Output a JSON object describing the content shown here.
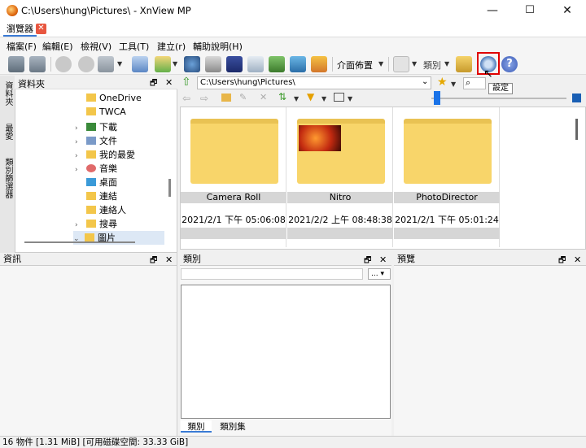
{
  "window": {
    "title": "C:\\Users\\hung\\Pictures\\ - XnView MP",
    "min": "—",
    "max": "☐",
    "close": "✕"
  },
  "tab": {
    "label": "瀏覽器",
    "close": "✕"
  },
  "menu": [
    "檔案(F)",
    "編輯(E)",
    "檢視(V)",
    "工具(T)",
    "建立(r)",
    "輔助說明(H)"
  ],
  "toolbar": {
    "layout_label": "介面佈置",
    "category_label": "類別",
    "settings_tooltip": "設定"
  },
  "sidebar_tabs": [
    "資料夾",
    "最愛",
    "類別篩選器"
  ],
  "folders_panel": {
    "title": "資料夾",
    "pin": "🗗",
    "close": "✕"
  },
  "tree": [
    {
      "label": "OneDrive",
      "expander": "",
      "icon": "folder"
    },
    {
      "label": "TWCA",
      "expander": "",
      "icon": "folder"
    },
    {
      "label": "下載",
      "expander": "›",
      "icon": "download"
    },
    {
      "label": "文件",
      "expander": "›",
      "icon": "doc"
    },
    {
      "label": "我的最愛",
      "expander": "›",
      "icon": "folder"
    },
    {
      "label": "音樂",
      "expander": "›",
      "icon": "music"
    },
    {
      "label": "桌面",
      "expander": "",
      "icon": "desktop"
    },
    {
      "label": "連結",
      "expander": "",
      "icon": "folder"
    },
    {
      "label": "連絡人",
      "expander": "",
      "icon": "folder"
    },
    {
      "label": "搜尋",
      "expander": "›",
      "icon": "folder"
    },
    {
      "label": "圖片",
      "expander": "⌄",
      "icon": "folder"
    }
  ],
  "path": {
    "value": "C:\\Users\\hung\\Pictures\\",
    "dropdown": "⌄"
  },
  "thumbnails": [
    {
      "name": "Camera Roll",
      "date": "2021/2/1 下午 05:06:08",
      "has_image": false
    },
    {
      "name": "Nitro",
      "date": "2021/2/2 上午 08:48:38",
      "has_image": true
    },
    {
      "name": "PhotoDirector",
      "date": "2021/2/1 下午 05:01:24",
      "has_image": false
    }
  ],
  "panels": {
    "info": "資訊",
    "categories": "類別",
    "preview": "預覽"
  },
  "category_tabs": [
    "類別",
    "類別集"
  ],
  "category_filter_btn": "...",
  "status": "16 物件 [1.31 MiB] [可用磁碟空間: 33.33 GiB]",
  "colors": {
    "accent": "#3a7bd5",
    "highlight": "#e00000",
    "folder": "#f8d56a"
  }
}
